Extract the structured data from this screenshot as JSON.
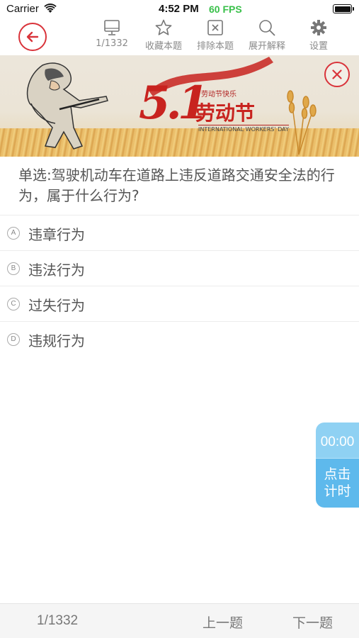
{
  "status_bar": {
    "carrier": "Carrier",
    "time": "4:52 PM",
    "fps": "60 FPS"
  },
  "toolbar": {
    "items": [
      {
        "label": "1/1332",
        "icon": "monitor-icon"
      },
      {
        "label": "收藏本题",
        "icon": "star-icon"
      },
      {
        "label": "排除本题",
        "icon": "close-box-icon"
      },
      {
        "label": "展开解释",
        "icon": "search-icon"
      },
      {
        "label": "设置",
        "icon": "gear-icon"
      }
    ]
  },
  "banner": {
    "number": "5.1",
    "title": "劳动节",
    "small_text": "劳动节快乐",
    "subtitle": "INTERNATIONAL WORKERS' DAY"
  },
  "question": {
    "text": "单选:驾驶机动车在道路上违反道路交通安全法的行为，属于什么行为?"
  },
  "options": [
    {
      "letter": "A",
      "text": "违章行为"
    },
    {
      "letter": "B",
      "text": "违法行为"
    },
    {
      "letter": "C",
      "text": "过失行为"
    },
    {
      "letter": "D",
      "text": "违规行为"
    }
  ],
  "timer": {
    "time": "00:00",
    "button_label_line1": "点击",
    "button_label_line2": "计时"
  },
  "bottom_bar": {
    "count": "1/1332",
    "prev_label": "上一题",
    "next_label": "下一题"
  },
  "colors": {
    "accent_red": "#d9333a",
    "fps_green": "#39c04a",
    "timer_blue": "#5eb9ec"
  }
}
